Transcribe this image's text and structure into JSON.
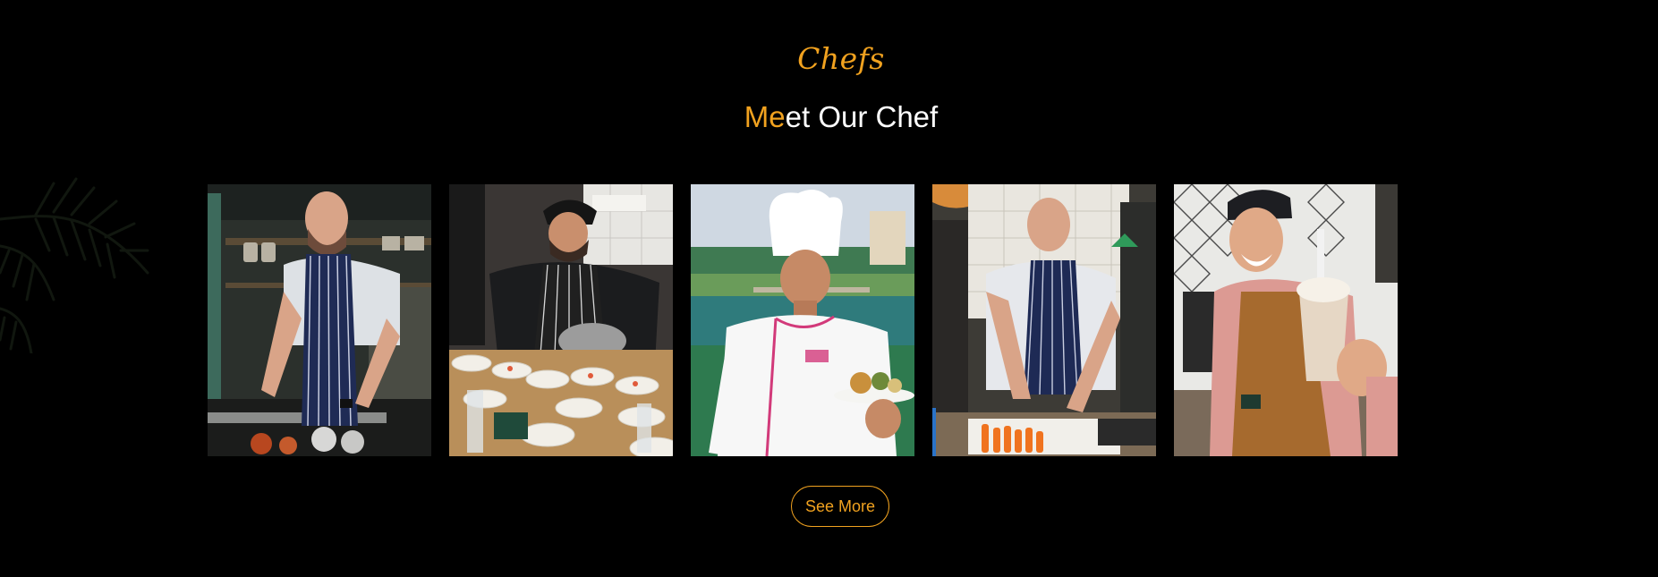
{
  "section": {
    "kicker": "Chefs",
    "title_accent": "Me",
    "title_rest": "et Our Chef"
  },
  "gallery": {
    "photos": [
      {
        "subject": "chef in striped apron plating in kitchen"
      },
      {
        "subject": "chef in black cap plating many dishes"
      },
      {
        "subject": "chef in white hat holding plate outdoors"
      },
      {
        "subject": "chef cutting carrots on board"
      },
      {
        "subject": "smiling barista holding iced drink"
      }
    ]
  },
  "actions": {
    "see_more_label": "See More"
  },
  "colors": {
    "background": "#000000",
    "accent": "#f1a21f",
    "text": "#ffffff"
  }
}
